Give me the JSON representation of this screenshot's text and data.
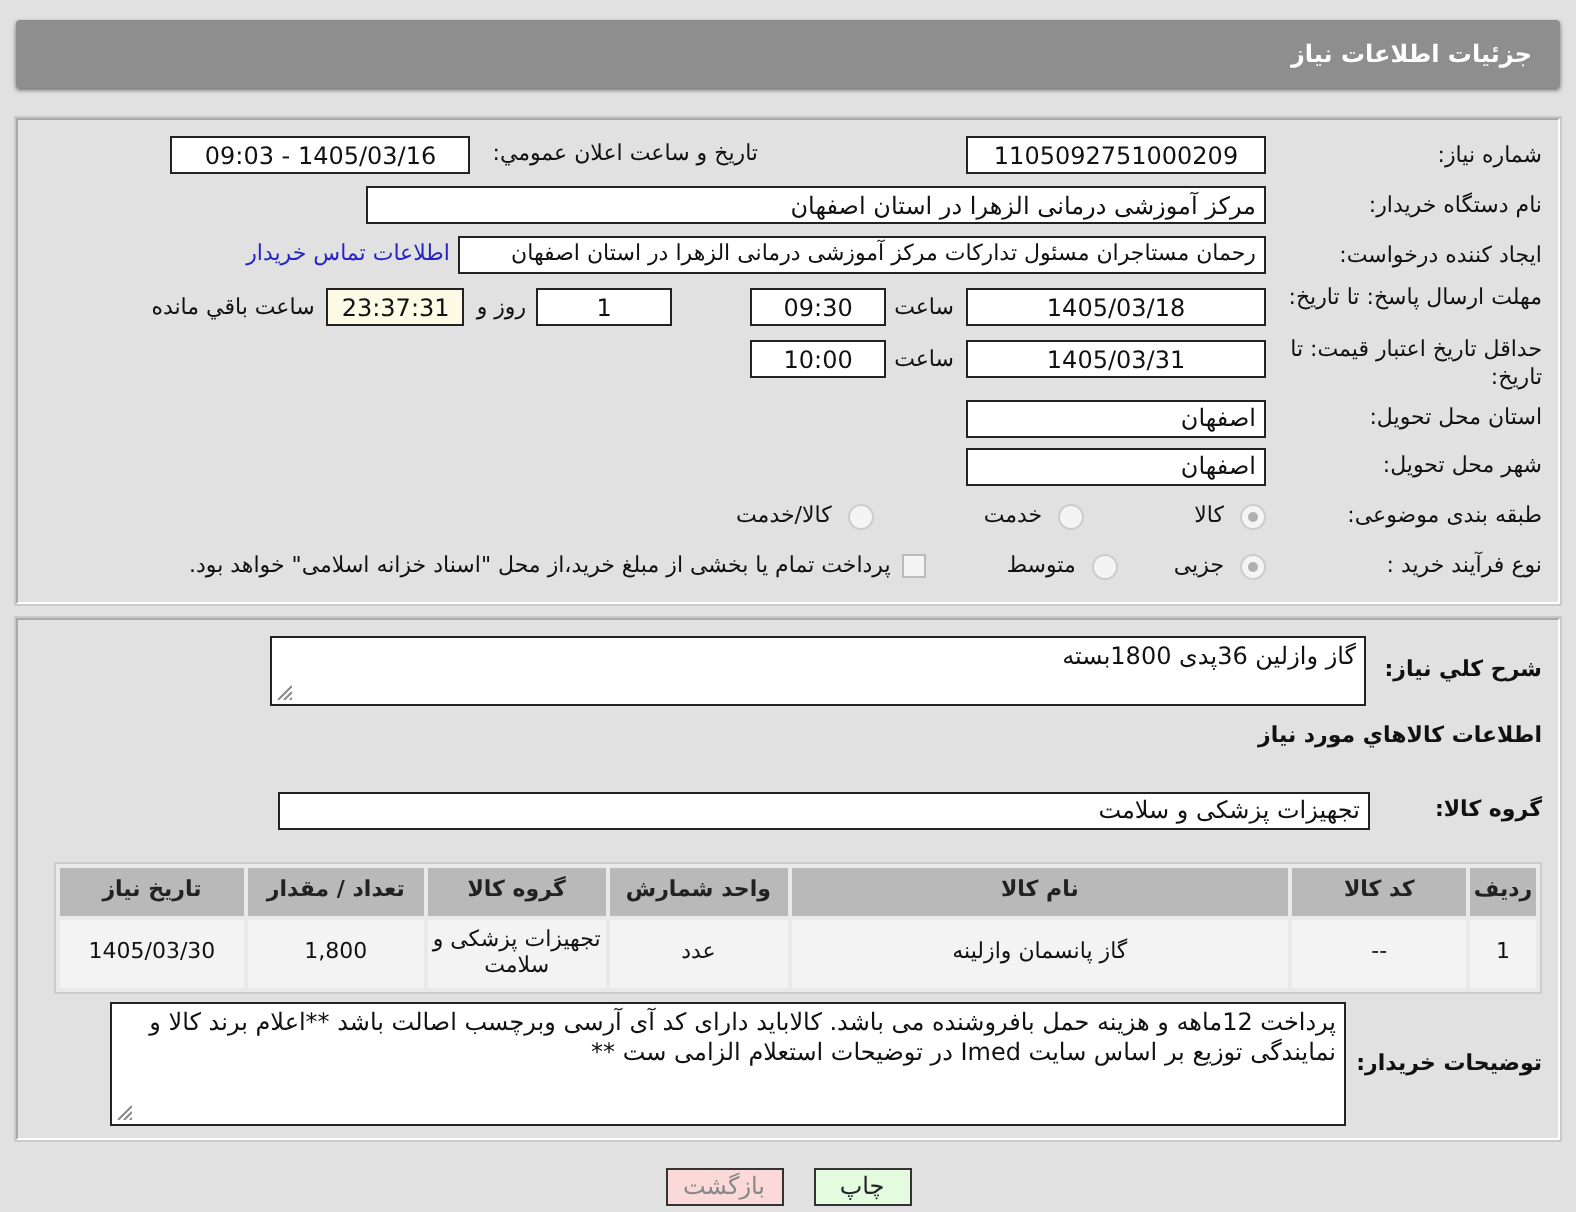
{
  "header": {
    "title": "جزئیات اطلاعات نیاز"
  },
  "need_number": {
    "label": "شماره نیاز:",
    "value": "1105092751000209"
  },
  "announce": {
    "label": "تاریخ و ساعت اعلان عمومي:",
    "value": "1405/03/16 - 09:03"
  },
  "buyer_org": {
    "label": "نام دستگاه خریدار:",
    "value": "مرکز آموزشی درمانی الزهرا در استان اصفهان"
  },
  "requester": {
    "label": "ایجاد کننده درخواست:",
    "value": "رحمان مستاجران مسئول تدارکات مرکز آموزشی درمانی الزهرا در استان اصفهان",
    "link": "اطلاعات تماس خریدار"
  },
  "response_deadline": {
    "label": "مهلت ارسال پاسخ: تا تاریخ:",
    "date": "1405/03/18",
    "time_label": "ساعت",
    "time": "09:30",
    "days": "1",
    "days_label": "روز و",
    "remaining": "23:37:31",
    "remaining_label": "ساعت باقي مانده"
  },
  "price_validity": {
    "label": "حداقل تاریخ اعتبار قیمت: تا تاریخ:",
    "date": "1405/03/31",
    "time_label": "ساعت",
    "time": "10:00"
  },
  "province": {
    "label": "استان محل تحویل:",
    "value": "اصفهان"
  },
  "city": {
    "label": "شهر محل تحویل:",
    "value": "اصفهان"
  },
  "category": {
    "label": "طبقه بندی موضوعی:",
    "options": [
      {
        "label": "کالا",
        "selected": true
      },
      {
        "label": "خدمت",
        "selected": false
      },
      {
        "label": "کالا/خدمت",
        "selected": false
      }
    ]
  },
  "process": {
    "label": "نوع فرآیند خرید :",
    "options": [
      {
        "label": "جزیی",
        "selected": true
      },
      {
        "label": "متوسط",
        "selected": false
      }
    ],
    "treasury": {
      "label": "پرداخت تمام یا بخشی از مبلغ خرید،از محل \"اسناد خزانه اسلامی\" خواهد بود.",
      "checked": false
    }
  },
  "description": {
    "label": "شرح کلي نياز:",
    "value": "گاز وازلین 36پدی 1800بسته"
  },
  "items_heading": "اطلاعات کالاهاي مورد نياز",
  "goods_group": {
    "label": "گروه کالا:",
    "value": "تجهیزات پزشکی و سلامت"
  },
  "table": {
    "columns": [
      "ردیف",
      "کد کالا",
      "نام کالا",
      "واحد شمارش",
      "گروه کالا",
      "تعداد / مقدار",
      "تاریخ نیاز"
    ],
    "rows": [
      [
        "1",
        "--",
        "گاز پانسمان وازلینه",
        "عدد",
        "تجهیزات پزشکی و سلامت",
        "1,800",
        "1405/03/30"
      ]
    ]
  },
  "buyer_notes": {
    "label": "توضیحات خریدار:",
    "value": "پرداخت 12ماهه و هزینه حمل بافروشنده می باشد. کالاباید دارای کد آی آرسی وبرچسب اصالت باشد  **اعلام برند کالا و نمایندگی توزیع بر اساس سایت Imed در توضیحات استعلام الزامی ست **"
  },
  "buttons": [
    {
      "label": "چاپ",
      "kind": "print"
    },
    {
      "label": "بازگشت",
      "kind": "back"
    }
  ]
}
